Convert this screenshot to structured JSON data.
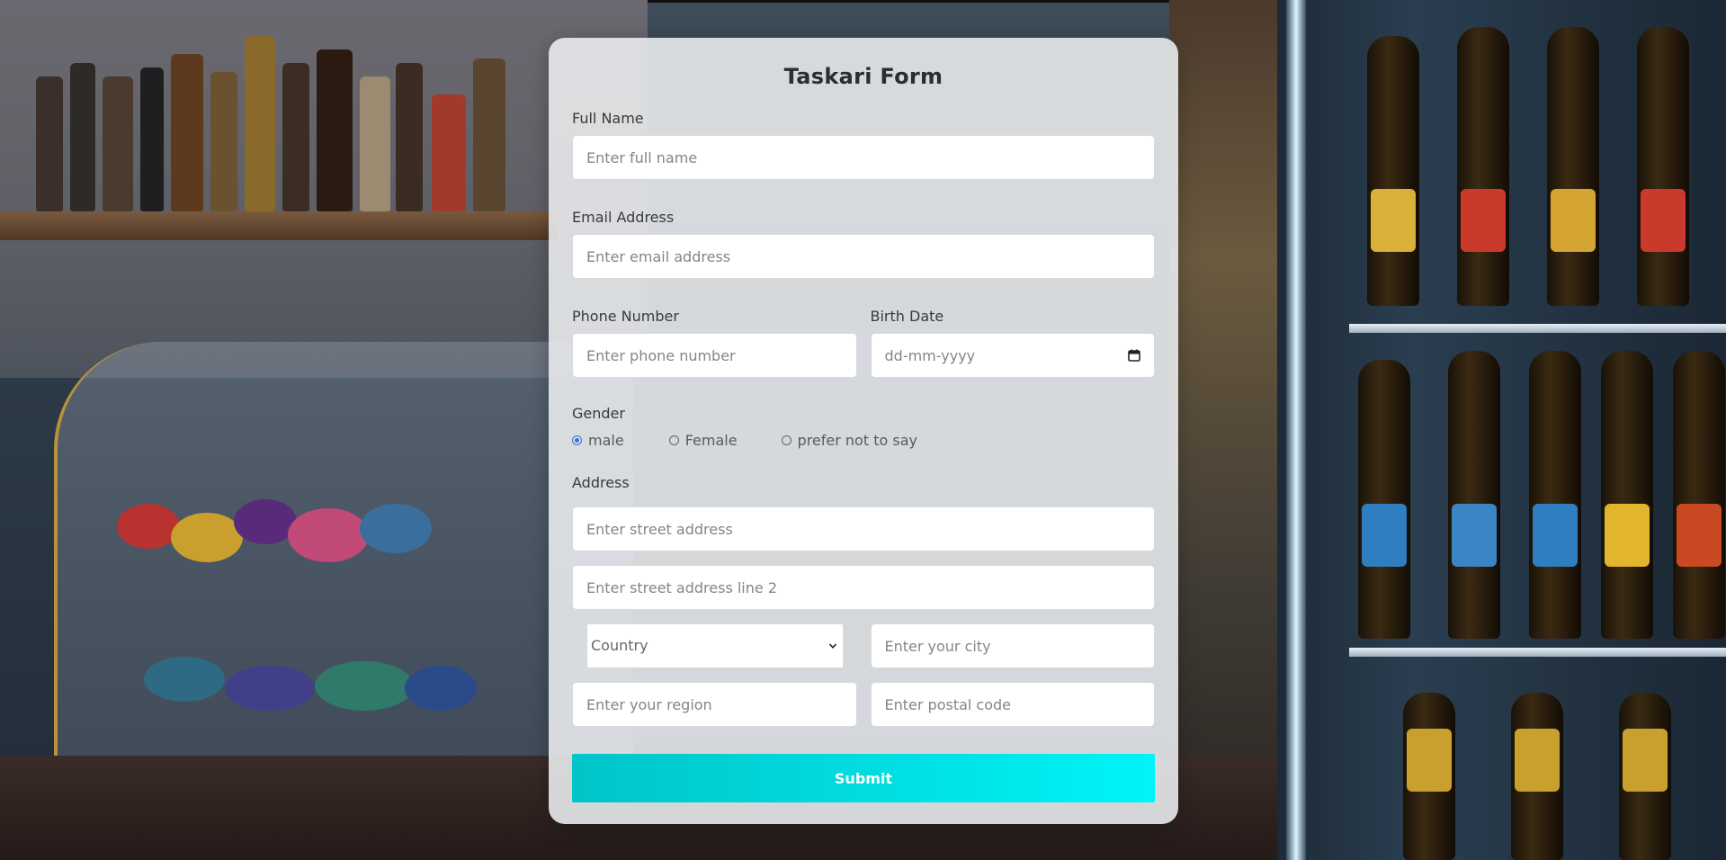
{
  "form": {
    "title": "Taskari Form",
    "full_name": {
      "label": "Full Name",
      "placeholder": "Enter full name",
      "value": ""
    },
    "email": {
      "label": "Email Address",
      "placeholder": "Enter email address",
      "value": ""
    },
    "phone": {
      "label": "Phone Number",
      "placeholder": "Enter phone number",
      "value": ""
    },
    "birth_date": {
      "label": "Birth Date",
      "display": "dd-mm-yyyy",
      "icon": "calendar-icon"
    },
    "gender": {
      "label": "Gender",
      "options": [
        {
          "label": "male",
          "selected": true
        },
        {
          "label": "Female",
          "selected": false
        },
        {
          "label": "prefer not to say",
          "selected": false
        }
      ]
    },
    "address": {
      "label": "Address",
      "street1_placeholder": "Enter street address",
      "street2_placeholder": "Enter street address line 2",
      "country_selected": "Country",
      "city_placeholder": "Enter your city",
      "region_placeholder": "Enter your region",
      "postal_placeholder": "Enter postal code"
    },
    "submit_label": "Submit"
  },
  "colors": {
    "submit_gradient_start": "#00c4c8",
    "submit_gradient_end": "#00f4f8",
    "radio_accent": "#3c73d8",
    "card_background": "#e8eaec"
  }
}
